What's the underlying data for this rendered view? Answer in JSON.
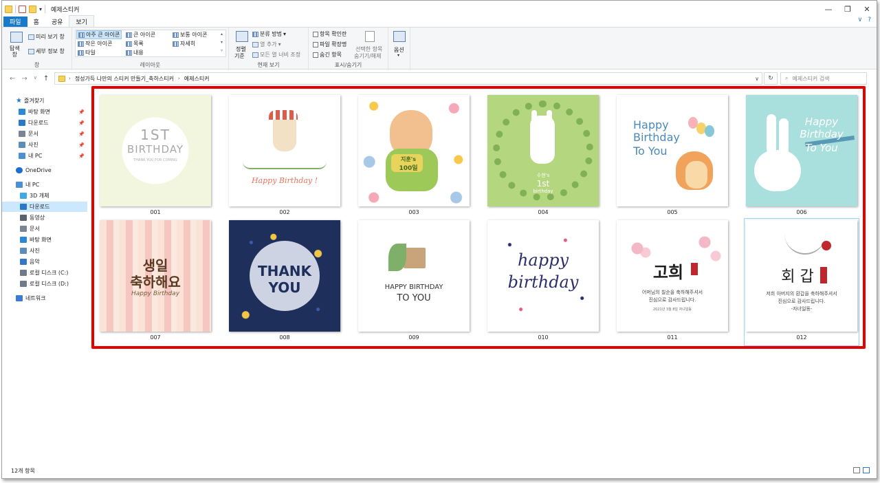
{
  "window": {
    "title": "예제스티커"
  },
  "tabs": [
    {
      "label": "파일"
    },
    {
      "label": "홈"
    },
    {
      "label": "공유"
    },
    {
      "label": "보기"
    }
  ],
  "ribbon": {
    "pane_group": {
      "nav_pane": "탐색\n창",
      "preview": "미리 보기 창",
      "details": "세부 정보 창",
      "label": "창"
    },
    "layout_group": {
      "items": [
        "아주 큰 아이콘",
        "큰 아이콘",
        "보통 아이콘",
        "작은 아이콘",
        "목록",
        "자세히",
        "타일",
        "내용"
      ],
      "label": "레이아웃"
    },
    "current_view_group": {
      "sort": "정렬",
      "sort2": "기준",
      "group_by": "분류 방법",
      "add_column": "열 추가",
      "fit_columns": "모든 열 너비 조정",
      "label": "현재 보기"
    },
    "show_hide_group": {
      "item_checkbox": "항목 확인란",
      "file_ext": "파일 확장명",
      "hidden_items": "숨긴 항목",
      "hide_selected": "선택한 항목",
      "hide_selected2": "숨기기/해제",
      "label": "표시/숨기기"
    },
    "options": "옵션"
  },
  "address": {
    "crumbs": [
      "정성가득 나만의 스티커 만들기_축하스티커",
      "예제스티커"
    ],
    "search_placeholder": "예제스티커 검색"
  },
  "nav": {
    "quick_access": "즐겨찾기",
    "quick": [
      {
        "label": "바탕 화면",
        "color": "#2b88d8"
      },
      {
        "label": "다운로드",
        "color": "#2b78c9"
      },
      {
        "label": "문서",
        "color": "#7a8593"
      },
      {
        "label": "사진",
        "color": "#5b8db8"
      },
      {
        "label": "내 PC",
        "color": "#4a90d9"
      }
    ],
    "onedrive": "OneDrive",
    "this_pc": "내 PC",
    "pc": [
      {
        "label": "3D 개체",
        "color": "#3fa9e8"
      },
      {
        "label": "다운로드",
        "color": "#2b78c9"
      },
      {
        "label": "동영상",
        "color": "#5a6270"
      },
      {
        "label": "문서",
        "color": "#7a8593"
      },
      {
        "label": "바탕 화면",
        "color": "#2b88d8"
      },
      {
        "label": "사진",
        "color": "#5b8db8"
      },
      {
        "label": "음악",
        "color": "#3577c6"
      },
      {
        "label": "로컬 디스크 (C:)",
        "color": "#6c7a89"
      },
      {
        "label": "로컬 디스크 (D:)",
        "color": "#6c7a89"
      }
    ],
    "network": "네트워크"
  },
  "files": [
    {
      "name": "001",
      "l1": "1ST",
      "l2": "BIRTHDAY",
      "l3": "THANK YOU FOR COMING"
    },
    {
      "name": "002",
      "l1": "Happy Birthday !"
    },
    {
      "name": "003",
      "l1": "지훈's",
      "l2": "100일"
    },
    {
      "name": "004",
      "l1": "수현's",
      "l2": "1st",
      "l3": "birthday"
    },
    {
      "name": "005",
      "l1": "Happy",
      "l2": "Birthday",
      "l3": "To You"
    },
    {
      "name": "006",
      "l1": "Happy",
      "l2": "Birthday",
      "l3": "To You"
    },
    {
      "name": "007",
      "l1": "생일",
      "l2": "축하해요",
      "l3": "Happy Birthday"
    },
    {
      "name": "008",
      "l1": "THANK",
      "l2": "YOU"
    },
    {
      "name": "009",
      "l1": "HAPPY BIRTHDAY",
      "l2": "TO YOU"
    },
    {
      "name": "010",
      "l1": "happy",
      "l2": "birthday"
    },
    {
      "name": "011",
      "l1": "고희",
      "l2": "어머님의 칠순을 축하해주셔서",
      "l3": "진심으로 감사드립니다.",
      "l4": "2021년 3월 8일 자녀일동"
    },
    {
      "name": "012",
      "l1": "회 갑",
      "l2": "저희 아버지의 환갑을 축하해주셔서",
      "l3": "진심으로 감사드립니다.",
      "l4": "-자녀일동-"
    }
  ],
  "status": {
    "count": "12개 항목"
  }
}
